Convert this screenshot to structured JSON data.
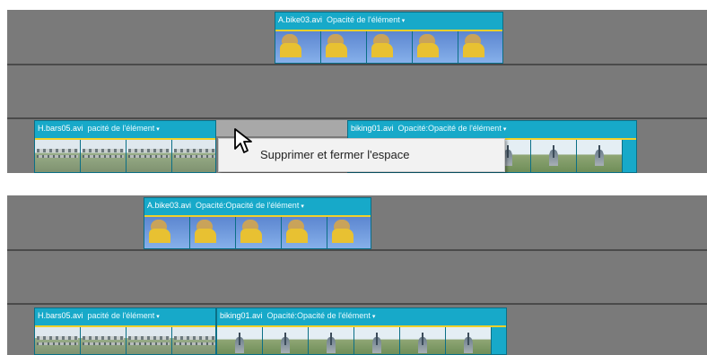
{
  "top_panel": {
    "track1_clip": {
      "name": "A.bike03.avi",
      "opacity_label": "Opacité de l'élément",
      "arrow": "▾"
    },
    "track3_clip_left": {
      "name": "H.bars05.avi",
      "opacity_label": "pacité de l'élément",
      "arrow": "▾"
    },
    "track3_clip_right": {
      "name": "biking01.avi",
      "opacity_label": "Opacité:Opacité de l'élément",
      "arrow": "▾"
    }
  },
  "context_menu": {
    "item": "Supprimer et fermer l'espace"
  },
  "bottom_panel": {
    "track1_clip": {
      "name": "A.bike03.avi",
      "opacity_label": "Opacité:Opacité de l'élément",
      "arrow": "▾"
    },
    "track3_clip_left": {
      "name": "H.bars05.avi",
      "opacity_label": "pacité de l'élément",
      "arrow": "▾"
    },
    "track3_clip_right": {
      "name": "biking01.avi",
      "opacity_label": "Opacité:Opacité de l'élément",
      "arrow": "▾"
    }
  },
  "colors": {
    "track_bg": "#7a7a7a",
    "clip": "#17a9c9",
    "opacity_line": "#f0d02a",
    "menu_bg": "#f2f2f2"
  },
  "icons": [
    "mouse-pointer-icon"
  ]
}
